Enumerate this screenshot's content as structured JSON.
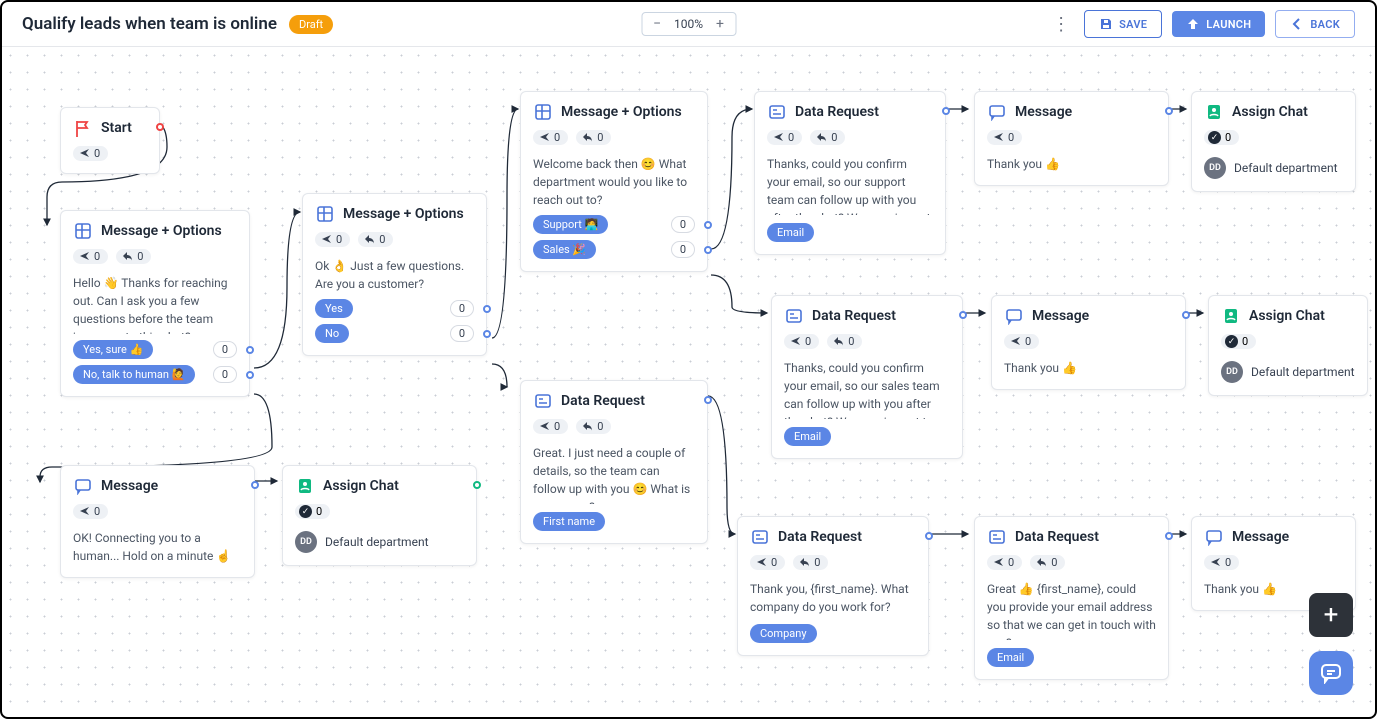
{
  "header": {
    "title": "Qualify leads when team is online",
    "status": "Draft",
    "zoom": "100%",
    "save": "SAVE",
    "launch": "LAUNCH",
    "back": "BACK"
  },
  "nodes": {
    "start": {
      "title": "Start",
      "sent": "0"
    },
    "mo1": {
      "title": "Message + Options",
      "sent": "0",
      "recv": "0",
      "body": "Hello 👋 Thanks for reaching out. Can I ask you a few questions before the team jumps on to this chat?",
      "opts": [
        {
          "l": "Yes, sure 👍",
          "c": "0"
        },
        {
          "l": "No, talk to human 🙋",
          "c": "0"
        }
      ]
    },
    "msg1": {
      "title": "Message",
      "sent": "0",
      "body": "OK! Connecting you to a human... Hold on a minute ☝️"
    },
    "assign1": {
      "title": "Assign Chat",
      "c": "0",
      "dept": "Default department"
    },
    "mo2": {
      "title": "Message + Options",
      "sent": "0",
      "recv": "0",
      "body": "Ok 👌 Just a few questions. Are you a customer?",
      "opts": [
        {
          "l": "Yes",
          "c": "0"
        },
        {
          "l": "No",
          "c": "0"
        }
      ]
    },
    "mo3": {
      "title": "Message + Options",
      "sent": "0",
      "recv": "0",
      "body": "Welcome back then 😊 What department would you like to reach out to?",
      "opts": [
        {
          "l": "Support 🧑‍💻",
          "c": "0"
        },
        {
          "l": "Sales 🎉",
          "c": "0"
        }
      ]
    },
    "data1": {
      "title": "Data Request",
      "sent": "0",
      "recv": "0",
      "body": "Great. I just need a couple of details, so the team can follow up with you 😊 What is your name?",
      "tag": "First name"
    },
    "data2": {
      "title": "Data Request",
      "sent": "0",
      "recv": "0",
      "body": "Thanks, could you confirm your email, so our support team can follow up with you after the chat? We promise not to spam you 😇",
      "tag": "Email"
    },
    "data3": {
      "title": "Data Request",
      "sent": "0",
      "recv": "0",
      "body": "Thanks, could you confirm your email, so our sales team can follow up with you after the chat? We promise not to spam you 😇",
      "tag": "Email"
    },
    "data4": {
      "title": "Data Request",
      "sent": "0",
      "recv": "0",
      "body": "Thank you, {first_name}. What company do you work for?",
      "tag": "Company"
    },
    "data5": {
      "title": "Data Request",
      "sent": "0",
      "recv": "0",
      "body": "Great 👍 {first_name}, could you provide your email address so that we can get in touch with you?",
      "tag": "Email"
    },
    "msg2": {
      "title": "Message",
      "sent": "0",
      "body": "Thank you 👍"
    },
    "msg3": {
      "title": "Message",
      "sent": "0",
      "body": "Thank you 👍"
    },
    "msg4": {
      "title": "Message",
      "sent": "0",
      "body": "Thank you 👍"
    },
    "assign2": {
      "title": "Assign Chat",
      "c": "0",
      "dept": "Default department"
    },
    "assign3": {
      "title": "Assign Chat",
      "c": "0",
      "dept": "Default department"
    }
  }
}
